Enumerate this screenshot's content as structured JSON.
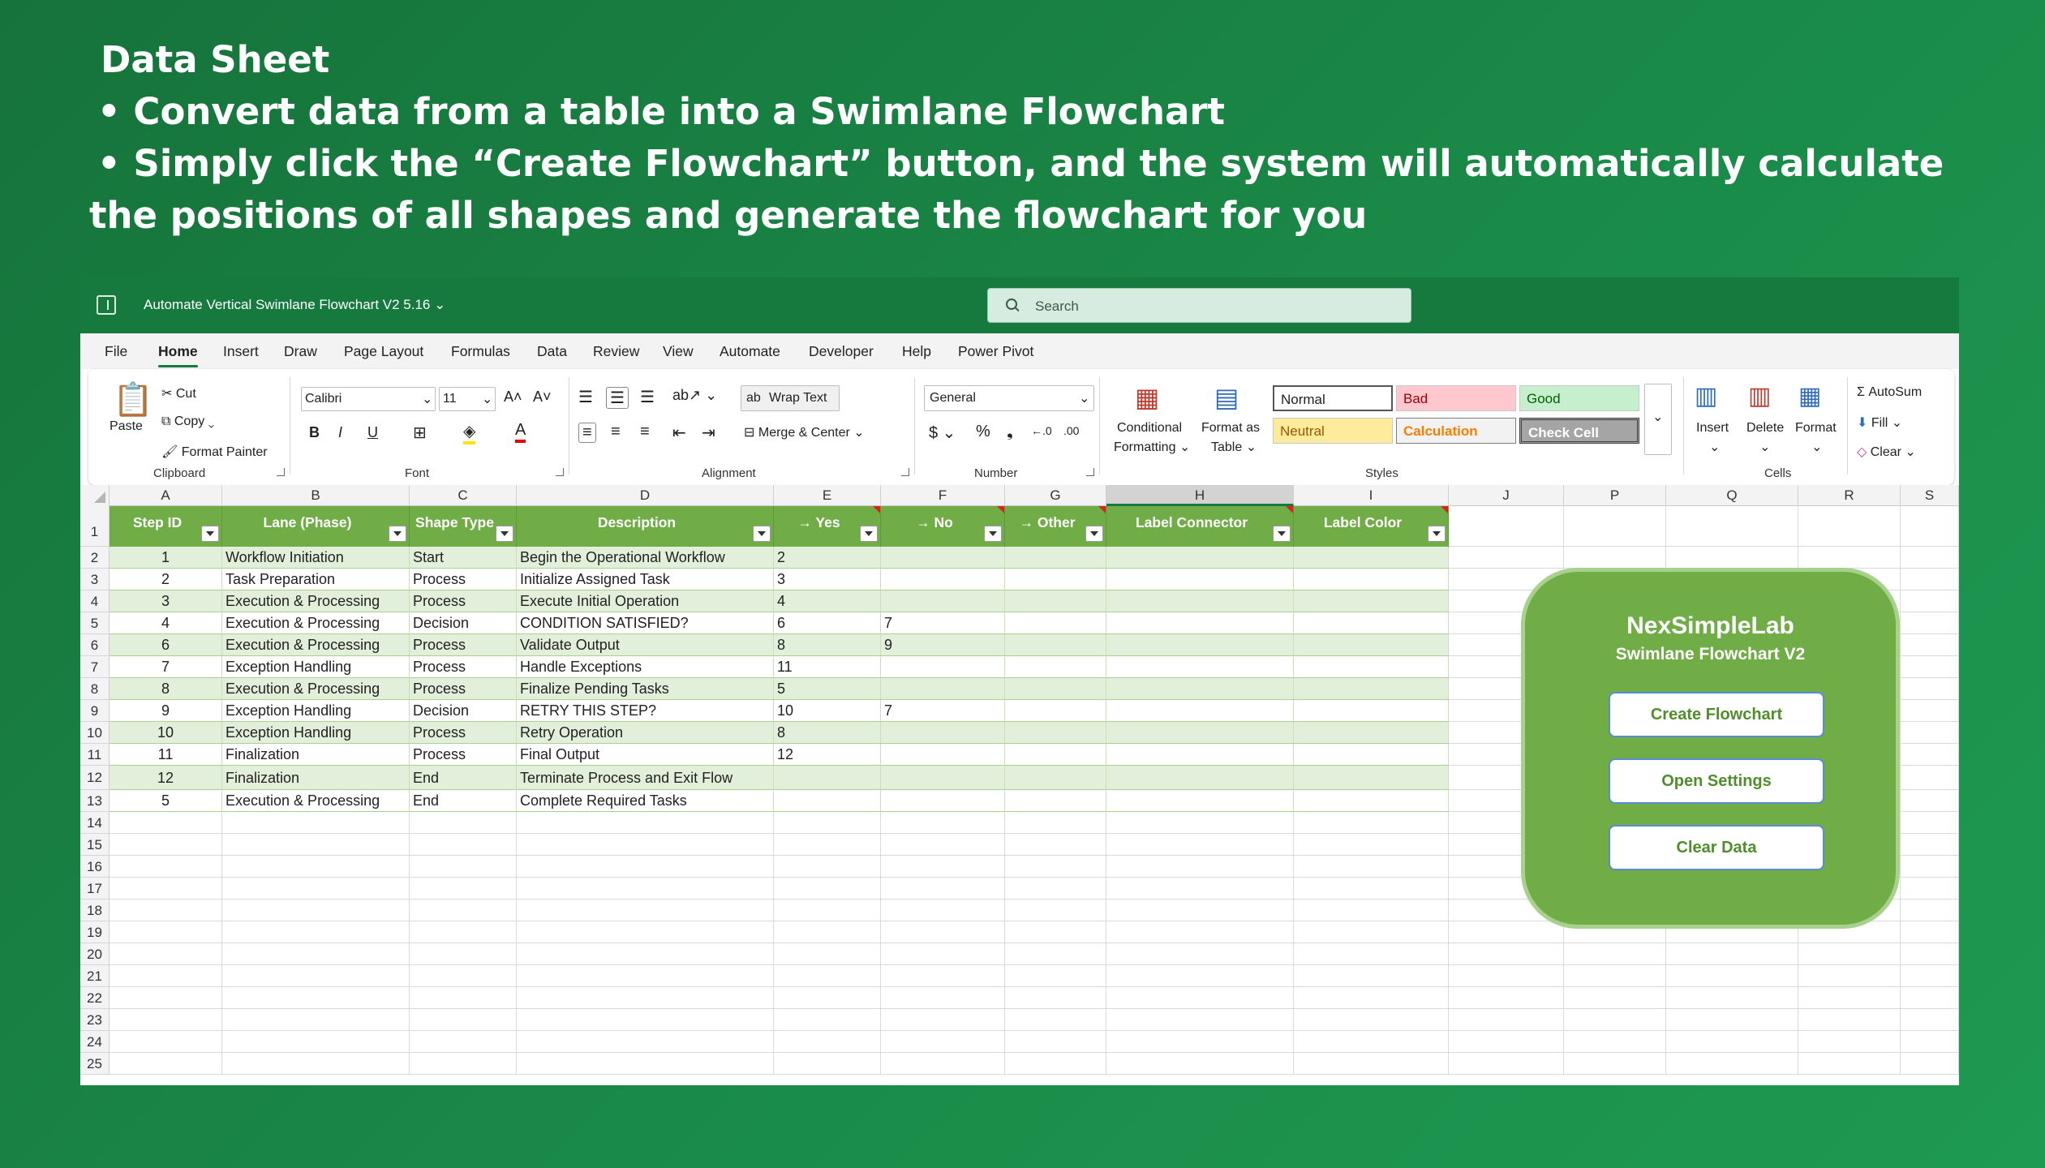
{
  "headline": {
    "title": "Data Sheet",
    "bullet1": "• Convert data from a table into a Swimlane Flowchart",
    "bullet2_line1": "• Simply click the “Create Flowchart” button, and the system will automatically calculate",
    "bullet2_line2": "the positions of all shapes and generate the flowchart for you"
  },
  "window": {
    "title": "Automate Vertical Swimlane Flowchart V2 5.16 ⌄",
    "search_placeholder": "Search"
  },
  "menu": [
    "File",
    "Home",
    "Insert",
    "Draw",
    "Page Layout",
    "Formulas",
    "Data",
    "Review",
    "View",
    "Automate",
    "Developer",
    "Help",
    "Power Pivot"
  ],
  "ribbon": {
    "clipboard": {
      "paste": "Paste",
      "cut": "Cut",
      "copy": "Copy",
      "format_painter": "Format Painter",
      "label": "Clipboard"
    },
    "font": {
      "name": "Calibri",
      "size": "11",
      "label": "Font"
    },
    "alignment": {
      "wrap_text": "Wrap Text",
      "merge_center": "Merge & Center",
      "label": "Alignment"
    },
    "number": {
      "format": "General",
      "label": "Number"
    },
    "styles": {
      "conditional": "Conditional",
      "formatting": "Formatting ⌄",
      "format_as": "Format as",
      "table": "Table ⌄",
      "normal": "Normal",
      "bad": "Bad",
      "good": "Good",
      "neutral": "Neutral",
      "calculation": "Calculation",
      "check_cell": "Check Cell",
      "label": "Styles"
    },
    "cells": {
      "insert": "Insert",
      "delete": "Delete",
      "format": "Format",
      "label": "Cells"
    },
    "editing": {
      "autosum": "AutoSum",
      "fill": "Fill ⌄",
      "clear": "Clear ⌄"
    }
  },
  "columns": [
    "A",
    "B",
    "C",
    "D",
    "E",
    "F",
    "G",
    "H",
    "I",
    "J",
    "P",
    "Q",
    "R",
    "S"
  ],
  "table": {
    "headers": [
      "Step ID",
      "Lane (Phase)",
      "Shape Type",
      "Description",
      "→ Yes",
      "→ No",
      "→ Other",
      "Label Connector",
      "Label Color"
    ],
    "rows": [
      [
        "1",
        "Workflow Initiation",
        "Start",
        "Begin the Operational Workflow",
        "2",
        "",
        "",
        "",
        ""
      ],
      [
        "2",
        "Task Preparation",
        "Process",
        "Initialize Assigned Task",
        "3",
        "",
        "",
        "",
        ""
      ],
      [
        "3",
        "Execution & Processing",
        "Process",
        "Execute Initial Operation",
        "4",
        "",
        "",
        "",
        ""
      ],
      [
        "4",
        "Execution & Processing",
        "Decision",
        "CONDITION SATISFIED?",
        "6",
        "7",
        "",
        "",
        ""
      ],
      [
        "6",
        "Execution & Processing",
        "Process",
        "Validate Output",
        "8",
        "9",
        "",
        "",
        ""
      ],
      [
        "7",
        "Exception Handling",
        "Process",
        "Handle Exceptions",
        "11",
        "",
        "",
        "",
        ""
      ],
      [
        "8",
        "Execution & Processing",
        "Process",
        "Finalize Pending Tasks",
        "5",
        "",
        "",
        "",
        ""
      ],
      [
        "9",
        "Exception Handling",
        "Decision",
        "RETRY THIS STEP?",
        "10",
        "7",
        "",
        "",
        ""
      ],
      [
        "10",
        "Exception Handling",
        "Process",
        "Retry Operation",
        "8",
        "",
        "",
        "",
        ""
      ],
      [
        "11",
        "Finalization",
        "Process",
        "Final Output",
        "12",
        "",
        "",
        "",
        ""
      ],
      [
        "12",
        "Finalization",
        "End",
        "Terminate Process and Exit Flow",
        "",
        "",
        "",
        "",
        ""
      ],
      [
        "5",
        "Execution & Processing",
        "End",
        "Complete Required Tasks",
        "",
        "",
        "",
        "",
        ""
      ]
    ]
  },
  "row_numbers": [
    "1",
    "2",
    "3",
    "4",
    "5",
    "6",
    "7",
    "8",
    "9",
    "10",
    "11",
    "12",
    "13",
    "14",
    "15",
    "16",
    "17",
    "18",
    "19",
    "20",
    "21",
    "22",
    "23",
    "24",
    "25"
  ],
  "panel": {
    "title": "NexSimpleLab",
    "subtitle": "Swimlane Flowchart V2",
    "create": "Create Flowchart",
    "settings": "Open Settings",
    "clear": "Clear Data"
  },
  "colors": {
    "header_green": "#70ad47",
    "title_bar": "#167a3e",
    "band": "#e2efda"
  }
}
